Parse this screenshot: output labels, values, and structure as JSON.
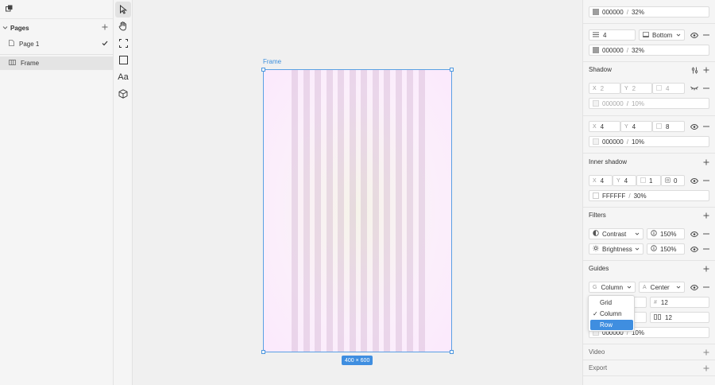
{
  "left_panel": {
    "pages_title": "Pages",
    "pages": [
      {
        "label": "Page 1",
        "selected": true
      }
    ],
    "layers": [
      {
        "label": "Frame"
      }
    ]
  },
  "toolbar": {
    "text_tool_label": "Aa"
  },
  "canvas": {
    "frame_label": "Frame",
    "frame_size": "400 × 600"
  },
  "right_panel": {
    "fill_top": {
      "hex": "000000",
      "opacity": "32%"
    },
    "stroke": {
      "width": "4",
      "position": "Bottom",
      "hex": "000000",
      "opacity": "32%"
    },
    "shadow": {
      "title": "Shadow",
      "items": [
        {
          "x": "2",
          "y": "2",
          "blur": "4",
          "hex": "000000",
          "opacity": "10%",
          "visible": false
        },
        {
          "x": "4",
          "y": "4",
          "blur": "8",
          "hex": "000000",
          "opacity": "10%",
          "visible": true
        }
      ]
    },
    "inner_shadow": {
      "title": "Inner shadow",
      "x": "4",
      "y": "4",
      "blur": "1",
      "spread": "0",
      "hex": "FFFFFF",
      "opacity": "30%"
    },
    "filters": {
      "title": "Filters",
      "items": [
        {
          "name": "Contrast",
          "value": "150%"
        },
        {
          "name": "Brightness",
          "value": "150%"
        }
      ]
    },
    "guides": {
      "title": "Guides",
      "type_prefix": "G",
      "type": "Column",
      "align_prefix": "A",
      "align": "Center",
      "count_prefix": "#",
      "count": "12",
      "gutter": "12",
      "hex": "000000",
      "opacity": "10%"
    },
    "video_title": "Video",
    "export_title": "Export",
    "slash": "/"
  },
  "guide_type_dropdown": {
    "options": [
      {
        "label": "Grid",
        "checked": false
      },
      {
        "label": "Column",
        "checked": true
      },
      {
        "label": "Row",
        "checked": false,
        "highlighted": true
      }
    ]
  },
  "colors": {
    "accent": "#3f8ee0",
    "frame_border": "#5aa1e4"
  }
}
